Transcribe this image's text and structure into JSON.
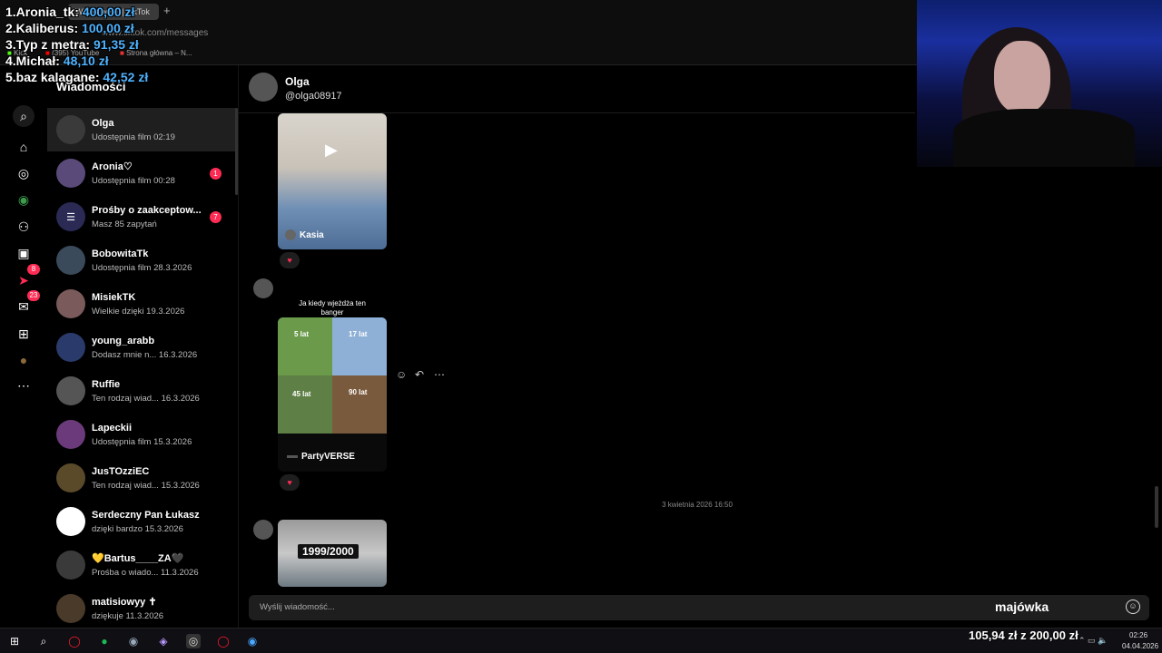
{
  "browser": {
    "tab_title": "Wiadomości | TikTok",
    "url": "www.tiktok.com/messages",
    "bookmarks": [
      "Kick",
      "(395) YouTube",
      "Strona główna – N..."
    ]
  },
  "overlay": {
    "donors": [
      {
        "rank_name": "1.Aronia_tk:",
        "amount": "400,00 zł"
      },
      {
        "rank_name": "2.Kaliberus:",
        "amount": "100,00 zł"
      },
      {
        "rank_name": "3.Typ z metra:",
        "amount": "91,35 zł"
      },
      {
        "rank_name": "4.Michał:",
        "amount": "48,10 zł"
      },
      {
        "rank_name": "5.baz kalagane:",
        "amount": "42,52 zł"
      }
    ],
    "goal": "105,94 zł z 200,00 zł"
  },
  "nav": {
    "items": [
      {
        "name": "search-icon",
        "glyph": "⌕"
      },
      {
        "name": "home-icon",
        "glyph": "⌂"
      },
      {
        "name": "explore-icon",
        "glyph": "◎"
      },
      {
        "name": "following-icon",
        "glyph": "◉"
      },
      {
        "name": "friends-icon",
        "glyph": "⚇"
      },
      {
        "name": "live-icon",
        "glyph": "▣"
      },
      {
        "name": "send-icon",
        "glyph": "➤",
        "badge": "8"
      },
      {
        "name": "inbox-icon",
        "glyph": "✉",
        "badge": "23"
      },
      {
        "name": "upload-icon",
        "glyph": "⊞"
      },
      {
        "name": "profile-icon",
        "glyph": "●"
      },
      {
        "name": "more-icon",
        "glyph": "⋯"
      }
    ]
  },
  "sidebar": {
    "title": "Wiadomości",
    "conversations": [
      {
        "name": "Olga",
        "sub": "Udostępnia film 02:19",
        "active": true
      },
      {
        "name": "Aronia♡",
        "sub": "Udostępnia film 00:28",
        "badge": "1"
      },
      {
        "name": "Prośby o zaakceptow...",
        "sub": "Masz 85 zapytań",
        "badge": "7"
      },
      {
        "name": "BobowitaTk",
        "sub": "Udostępnia film 28.3.2026"
      },
      {
        "name": "MisiekTK",
        "sub": "Wielkie dzięki 19.3.2026"
      },
      {
        "name": "young_arabb",
        "sub": "Dodasz mnie n... 16.3.2026"
      },
      {
        "name": "Ruffie",
        "sub": "Ten rodzaj wiad... 16.3.2026"
      },
      {
        "name": "Lapeckii",
        "sub": "Udostępnia film 15.3.2026"
      },
      {
        "name": "JusTOzziEC",
        "sub": "Ten rodzaj wiad... 15.3.2026"
      },
      {
        "name": "Serdeczny Pan Łukasz",
        "sub": "dzięki bardzo 15.3.2026"
      },
      {
        "name": "💛Bartus____ZA🖤",
        "sub": "Prośba o wiado... 11.3.2026"
      },
      {
        "name": "matisiowyy ✝",
        "sub": "dziękuje 11.3.2026"
      }
    ]
  },
  "chat": {
    "name": "Olga",
    "handle": "@olga08917",
    "videos": [
      {
        "label": "Kasia"
      },
      {
        "label": "PartyVERSE",
        "caption": "Ja kiedy wjeżdża ten banger",
        "tags": [
          "5 lat",
          "17 lat",
          "45 lat",
          "90 lat"
        ]
      },
      {
        "label": "",
        "overlay_text": "1999/2000"
      }
    ],
    "date_separator": "3 kwietnia 2026 16:50",
    "composer_placeholder": "Wyślij wiadomość...",
    "composer_overlay": "majówka"
  },
  "taskbar": {
    "time": "02:26",
    "date": "04.04.2026"
  },
  "colors": {
    "accent": "#fe2c55",
    "overlay_amount": "#4fb3ff",
    "background": "#000000"
  }
}
